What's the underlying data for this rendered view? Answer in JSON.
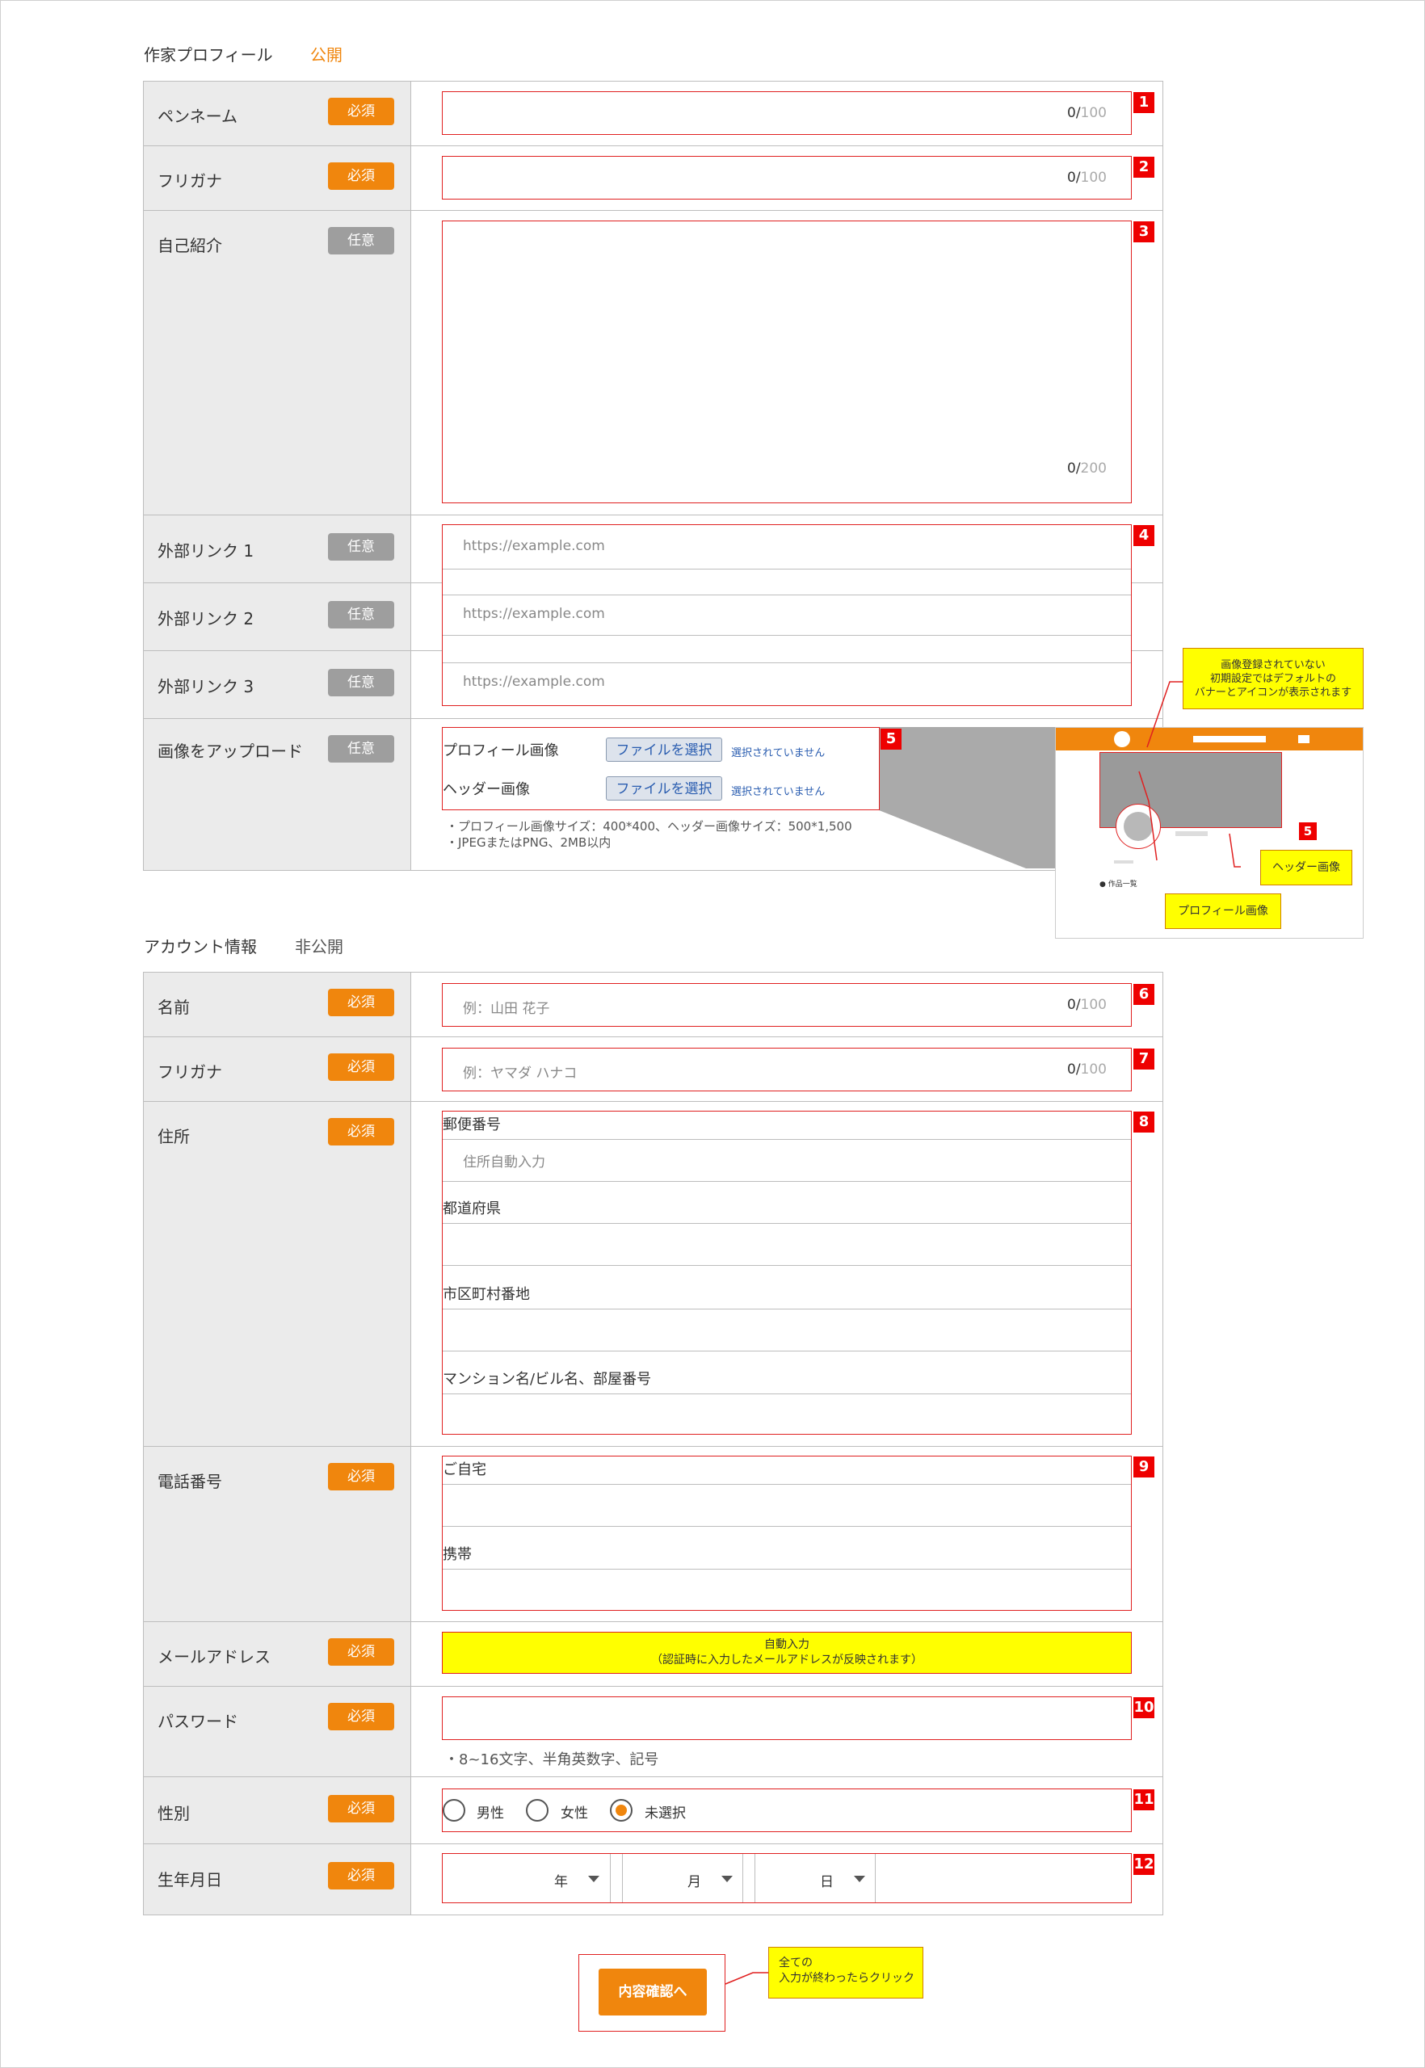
{
  "profile_section": {
    "title": "作家プロフィール",
    "status": "公開"
  },
  "account_section": {
    "title": "アカウント情報",
    "status": "非公開"
  },
  "badges": {
    "required": "必須",
    "optional": "任意"
  },
  "profile_rows": {
    "penname": {
      "label": "ペンネーム",
      "count": "0/",
      "max": "100",
      "marker": "1"
    },
    "furigana": {
      "label": "フリガナ",
      "count": "0/",
      "max": "100",
      "marker": "2"
    },
    "bio": {
      "label": "自己紹介",
      "count": "0/",
      "max": "200",
      "marker": "3"
    },
    "links": {
      "marker": "4",
      "items": [
        {
          "label": "外部リンク 1",
          "placeholder": "https://example.com"
        },
        {
          "label": "外部リンク 2",
          "placeholder": "https://example.com"
        },
        {
          "label": "外部リンク 3",
          "placeholder": "https://example.com"
        }
      ]
    },
    "upload": {
      "label": "画像をアップロード",
      "marker": "5",
      "profile_image_label": "プロフィール画像",
      "header_image_label": "ヘッダー画像",
      "file_button": "ファイルを選択",
      "no_file": "選択されていません",
      "notes": [
        "・プロフィール画像サイズ：400*400、ヘッダー画像サイズ：500*1,500",
        "・JPEGまたはPNG、2MB以内"
      ]
    }
  },
  "preview": {
    "callout_default": [
      "画像登録されていない",
      "初期設定ではデフォルトの",
      "バナーとアイコンが表示されます"
    ],
    "callout_header": "ヘッダー画像",
    "callout_profile": "プロフィール画像",
    "marker": "5",
    "works_list": "● 作品一覧"
  },
  "account_rows": {
    "name": {
      "label": "名前",
      "placeholder": "例：山田 花子",
      "count": "0/",
      "max": "100",
      "marker": "6"
    },
    "furigana": {
      "label": "フリガナ",
      "placeholder": "例：ヤマダ ハナコ",
      "count": "0/",
      "max": "100",
      "marker": "7"
    },
    "address": {
      "label": "住所",
      "marker": "8",
      "postal_label": "郵便番号",
      "postal_placeholder": "住所自動入力",
      "prefecture_label": "都道府県",
      "city_label": "市区町村番地",
      "building_label": "マンション名/ビル名、部屋番号"
    },
    "phone": {
      "label": "電話番号",
      "marker": "9",
      "home_label": "ご自宅",
      "mobile_label": "携帯"
    },
    "email": {
      "label": "メールアドレス",
      "auto_line1": "自動入力",
      "auto_line2": "（認証時に入力したメールアドレスが反映されます）"
    },
    "password": {
      "label": "パスワード",
      "marker": "10",
      "hint": "・8~16文字、半角英数字、記号"
    },
    "gender": {
      "label": "性別",
      "marker": "11",
      "options": [
        "男性",
        "女性",
        "未選択"
      ],
      "selected": "未選択"
    },
    "birthday": {
      "label": "生年月日",
      "marker": "12",
      "year": "年",
      "month": "月",
      "day": "日"
    }
  },
  "submit": {
    "label": "内容確認へ",
    "callout": [
      "全ての",
      "入力が終わったらクリック"
    ]
  },
  "colors": {
    "accent": "#f0860d",
    "marker_red": "#e00000",
    "callout_yellow": "#ffff00",
    "optional_gray": "#9e9e9e"
  }
}
